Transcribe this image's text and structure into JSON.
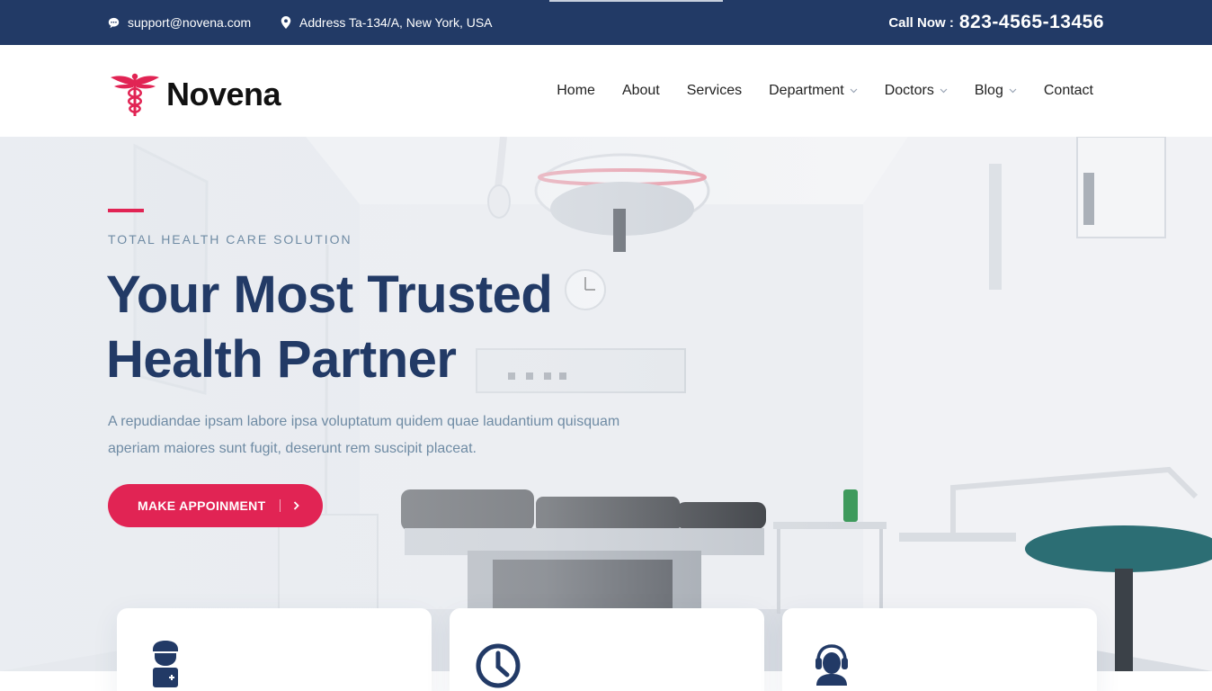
{
  "topbar": {
    "email": "support@novena.com",
    "address": "Address Ta-134/A, New York, USA",
    "call_label": "Call Now :",
    "call_number": "823-4565-13456"
  },
  "brand": {
    "name": "Novena"
  },
  "nav": {
    "items": [
      {
        "label": "Home",
        "has_dropdown": false
      },
      {
        "label": "About",
        "has_dropdown": false
      },
      {
        "label": "Services",
        "has_dropdown": false
      },
      {
        "label": "Department",
        "has_dropdown": true
      },
      {
        "label": "Doctors",
        "has_dropdown": true
      },
      {
        "label": "Blog",
        "has_dropdown": true
      },
      {
        "label": "Contact",
        "has_dropdown": false
      }
    ]
  },
  "hero": {
    "eyebrow": "TOTAL HEALTH CARE SOLUTION",
    "headline_line1": "Your Most Trusted",
    "headline_line2": "Health Partner",
    "lead": "A repudiandae ipsam labore ipsa voluptatum quidem quae laudantium quisquam aperiam maiores sunt fugit, deserunt rem suscipit placeat.",
    "cta_label": "MAKE APPOINMENT"
  },
  "cards": [
    {
      "icon": "doctor-icon"
    },
    {
      "icon": "clock-icon"
    },
    {
      "icon": "support-agent-icon"
    }
  ],
  "colors": {
    "primary": "#223a66",
    "accent": "#e12454",
    "muted": "#6f8ba4"
  }
}
